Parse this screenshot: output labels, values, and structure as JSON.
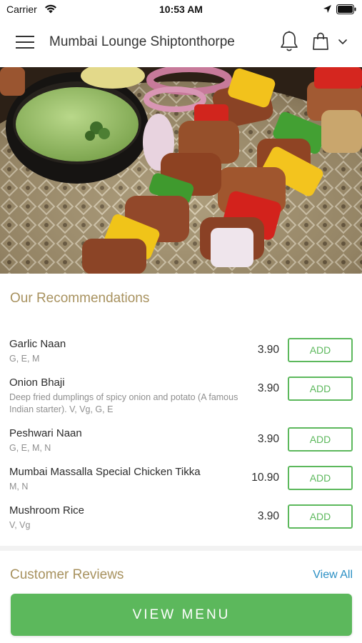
{
  "status_bar": {
    "carrier": "Carrier",
    "time": "10:53 AM"
  },
  "header": {
    "title": "Mumbai Lounge Shiptonthorpe",
    "icons": [
      "menu-icon",
      "bell-icon",
      "shopping-bag-icon",
      "chevron-down-icon"
    ]
  },
  "recommendations": {
    "title": "Our Recommendations",
    "add_label": "ADD",
    "items": [
      {
        "name": "Garlic Naan",
        "desc": "G, E, M",
        "price": "3.90"
      },
      {
        "name": "Onion Bhaji",
        "desc": "Deep fried dumplings of spicy onion and potato (A famous Indian starter).  V, Vg, G, E",
        "price": "3.90"
      },
      {
        "name": "Peshwari Naan",
        "desc": "G, E, M, N",
        "price": "3.90"
      },
      {
        "name": "Mumbai Massalla Special Chicken Tikka",
        "desc": "M, N",
        "price": "10.90"
      },
      {
        "name": "Mushroom Rice",
        "desc": "V, Vg",
        "price": "3.90"
      }
    ]
  },
  "reviews": {
    "title": "Customer Reviews",
    "view_all": "View All"
  },
  "view_menu_label": "VIEW MENU",
  "colors": {
    "accent_green": "#5cb85c",
    "section_title_gold": "#a8925f",
    "link_blue": "#2a8fc4"
  }
}
